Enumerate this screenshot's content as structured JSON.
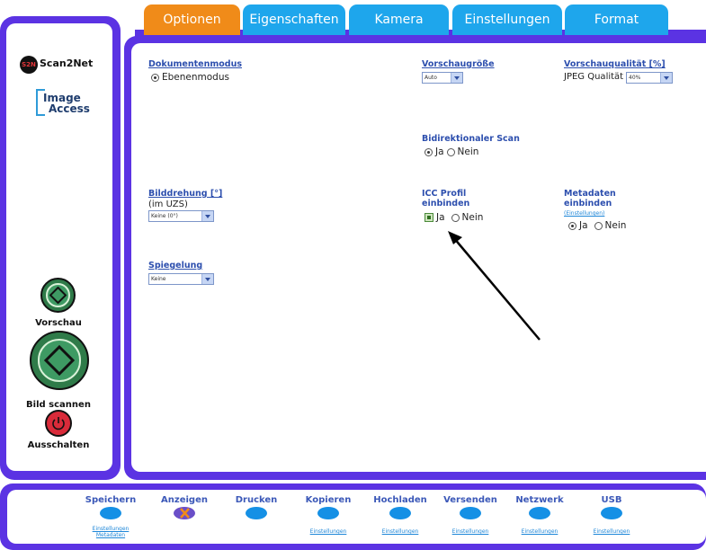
{
  "tabs": [
    {
      "label": "Optionen",
      "active": true
    },
    {
      "label": "Eigenschaften",
      "active": false
    },
    {
      "label": "Kamera",
      "active": false
    },
    {
      "label": "Einstellungen",
      "active": false
    },
    {
      "label": "Format",
      "active": false
    }
  ],
  "sidebar": {
    "brand": "Scan2Net",
    "brand_badge": "S2N",
    "logo_line1": "Image",
    "logo_line2": "Access",
    "preview_label": "Vorschau",
    "scan_label": "Bild scannen",
    "power_label": "Ausschalten"
  },
  "options": {
    "dokumentenmodus_label": "Dokumentenmodus",
    "dokumentenmodus_value": "Ebenenmodus",
    "vorschaugroesse_label": "Vorschaugröße",
    "vorschaugroesse_value": "Auto",
    "vorschauqualitaet_label": "Vorschauqualität [%]",
    "jpeg_label": "JPEG Qualität",
    "jpeg_value": "40%",
    "bidirektional_label": "Bidirektionaler Scan",
    "bidirektional_ja": "Ja",
    "bidirektional_nein": "Nein",
    "bilddrehung_label": "Bilddrehung [°]",
    "bilddrehung_sub": "(im UZS)",
    "bilddrehung_value": "Keine (0°)",
    "icc_label_1": "ICC Profil",
    "icc_label_2": "einbinden",
    "icc_ja": "Ja",
    "icc_nein": "Nein",
    "metadaten_label_1": "Metadaten",
    "metadaten_label_2": "einbinden",
    "metadaten_link": "(Einstellungen)",
    "metadaten_ja": "Ja",
    "metadaten_nein": "Nein",
    "spiegelung_label": "Spiegelung",
    "spiegelung_value": "Keine"
  },
  "bottom": [
    {
      "label": "Speichern",
      "sub": [
        "Einstellungen",
        "Metadaten"
      ]
    },
    {
      "label": "Anzeigen",
      "sub": []
    },
    {
      "label": "Drucken",
      "sub": []
    },
    {
      "label": "Kopieren",
      "sub": [
        "Einstellungen"
      ]
    },
    {
      "label": "Hochladen",
      "sub": [
        "Einstellungen"
      ]
    },
    {
      "label": "Versenden",
      "sub": [
        "Einstellungen"
      ]
    },
    {
      "label": "Netzwerk",
      "sub": [
        "Einstellungen"
      ]
    },
    {
      "label": "USB",
      "sub": [
        "Einstellungen"
      ]
    }
  ],
  "colors": {
    "frame": "#5b33e3",
    "tab": "#1ea6ec",
    "tab_active": "#f08b19",
    "label": "#2d4fae"
  }
}
